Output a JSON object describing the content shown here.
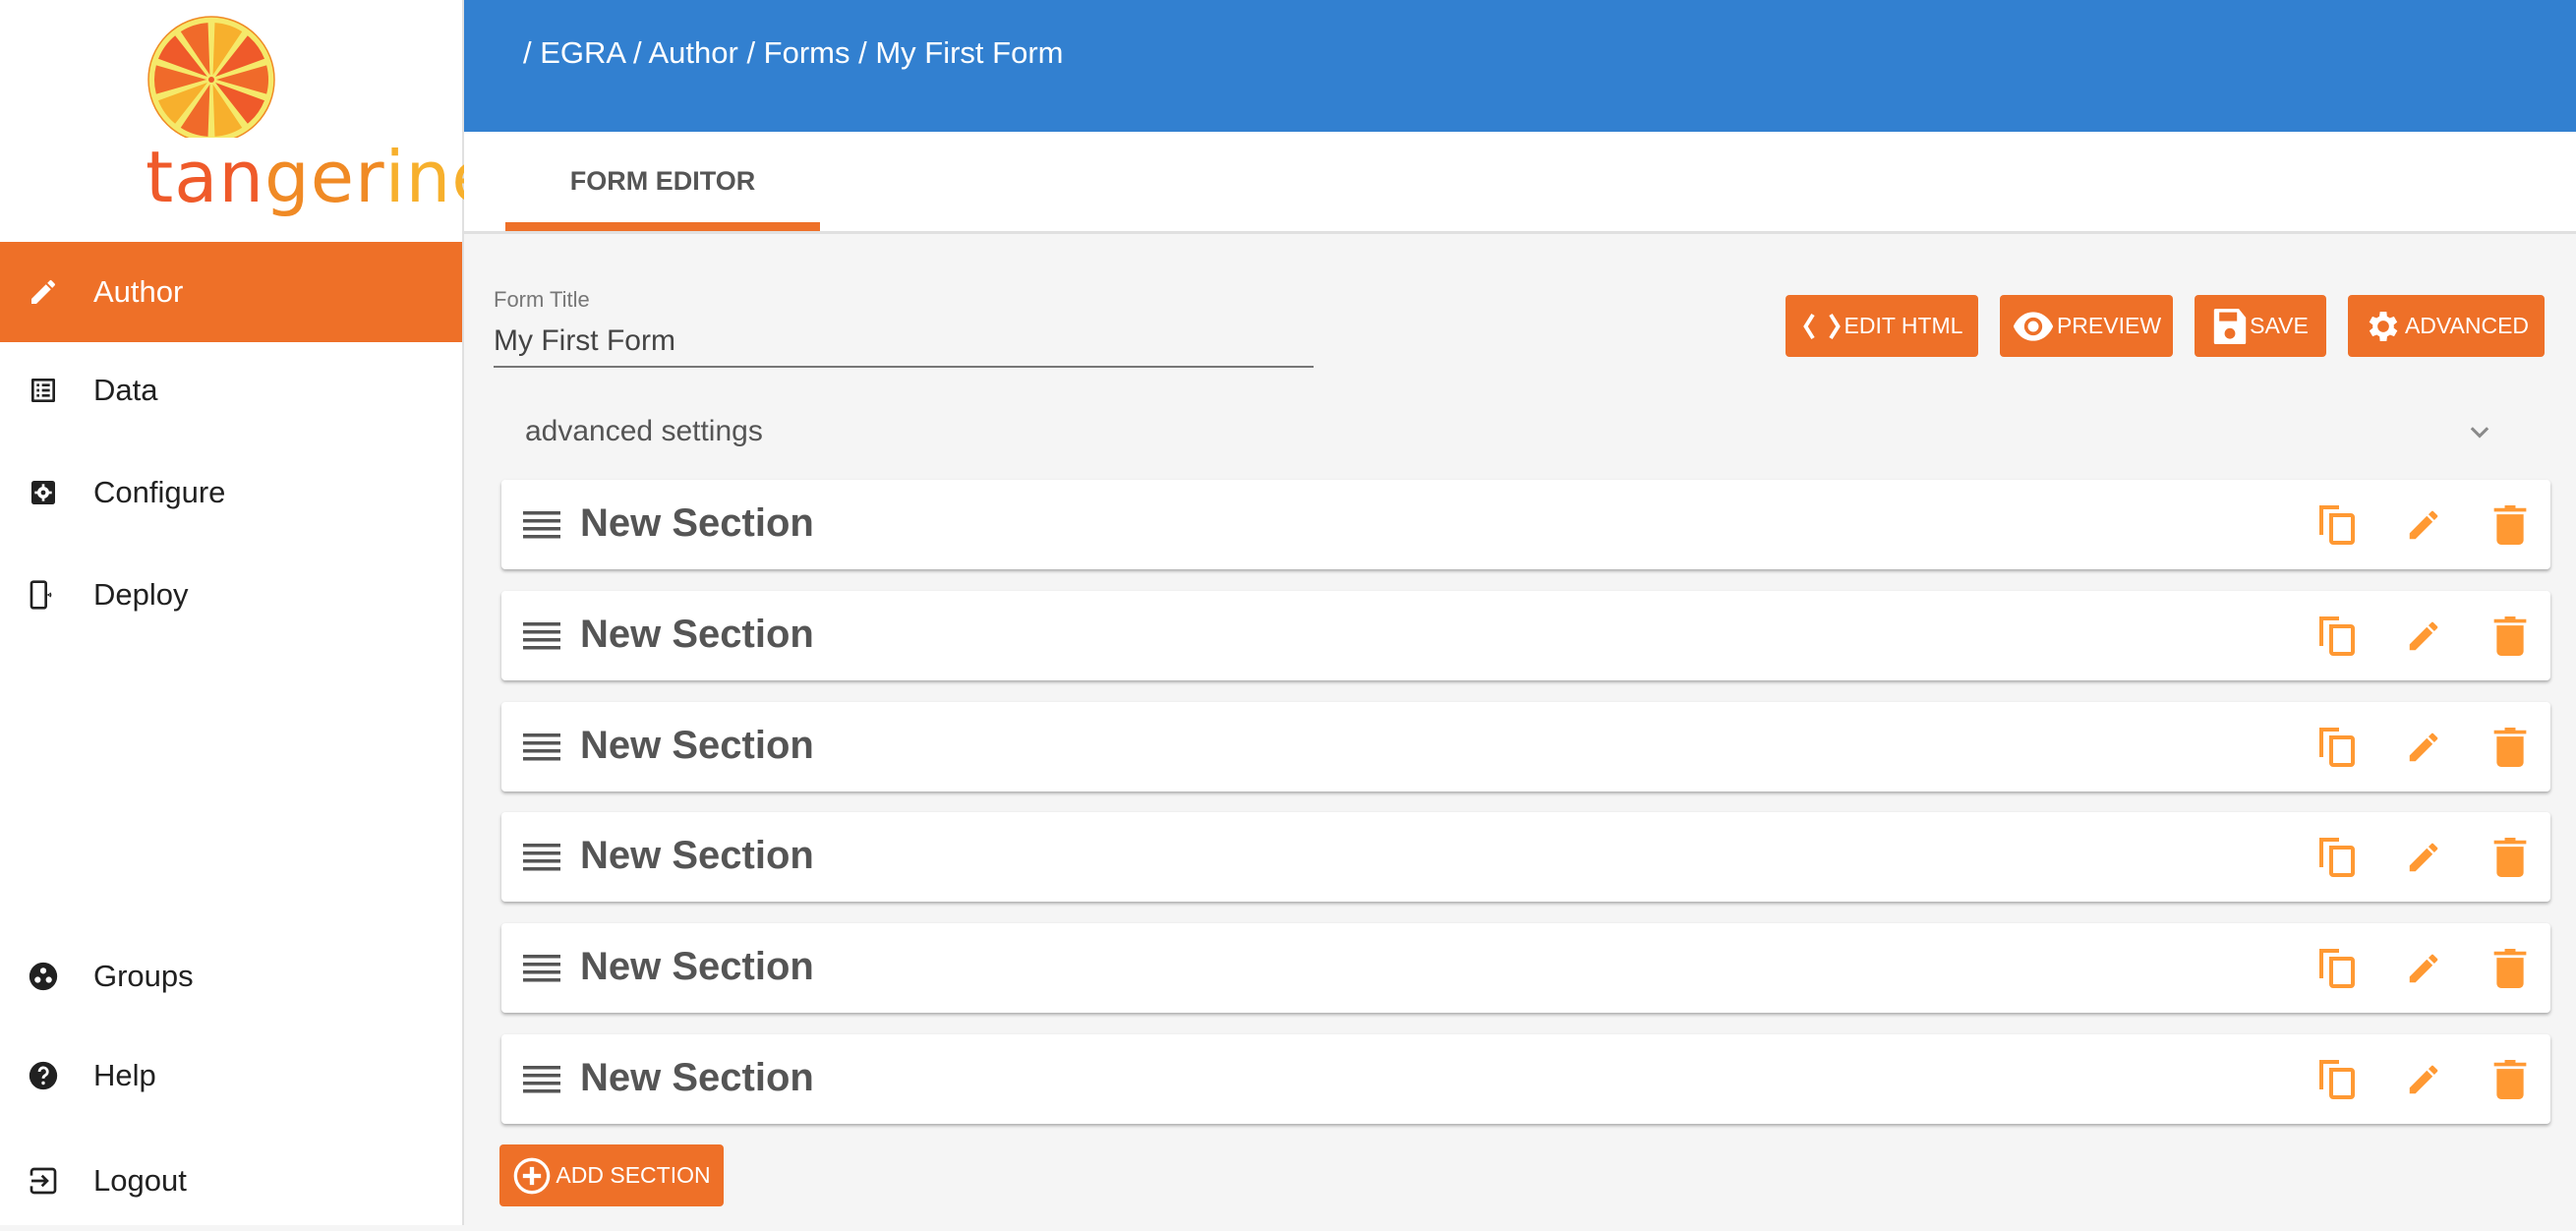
{
  "app": {
    "logo_text": {
      "part1": "tan",
      "part2": "ger",
      "part3": "ine",
      "mark": "®"
    },
    "brand_color": "#ee7028",
    "header_color": "#3280d0"
  },
  "sidebar": {
    "items": [
      {
        "label": "Author",
        "icon": "pencil-icon",
        "active": true
      },
      {
        "label": "Data",
        "icon": "list-icon",
        "active": false
      },
      {
        "label": "Configure",
        "icon": "settings-box-icon",
        "active": false
      },
      {
        "label": "Deploy",
        "icon": "phone-broadcast-icon",
        "active": false
      },
      {
        "label": "Groups",
        "icon": "groups-icon",
        "active": false
      },
      {
        "label": "Help",
        "icon": "help-circle-icon",
        "active": false
      },
      {
        "label": "Logout",
        "icon": "logout-icon",
        "active": false
      }
    ]
  },
  "header": {
    "breadcrumb": "/ EGRA / Author / Forms / My First Form"
  },
  "tabs": [
    {
      "label": "FORM EDITOR",
      "active": true
    }
  ],
  "form": {
    "title_label": "Form Title",
    "title_value": "My First Form",
    "advanced_settings_label": "advanced settings"
  },
  "toolbar": {
    "edit_html": "EDIT HTML",
    "preview": "PREVIEW",
    "save": "SAVE",
    "advanced": "ADVANCED"
  },
  "sections": [
    {
      "title": "New Section"
    },
    {
      "title": "New Section"
    },
    {
      "title": "New Section"
    },
    {
      "title": "New Section"
    },
    {
      "title": "New Section"
    },
    {
      "title": "New Section"
    }
  ],
  "add_section_label": "ADD SECTION",
  "action_icon_color": "#ff9933"
}
